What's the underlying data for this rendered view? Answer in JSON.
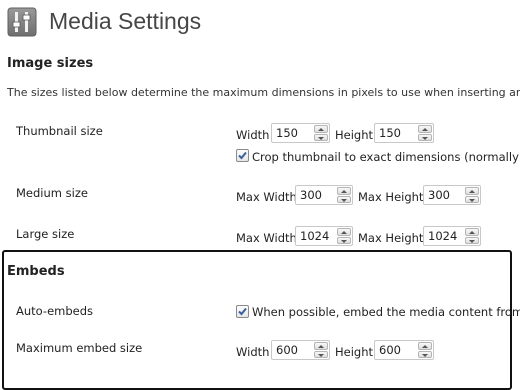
{
  "header": {
    "title": "Media Settings",
    "icon": "settings-sliders-icon"
  },
  "image_sizes": {
    "title": "Image sizes",
    "description": "The sizes listed below determine the maximum dimensions in pixels to use when inserting an",
    "thumbnail": {
      "label": "Thumbnail size",
      "width_label": "Width",
      "width_value": "150",
      "height_label": "Height",
      "height_value": "150",
      "crop_checked": true,
      "crop_label": "Crop thumbnail to exact dimensions (normally thu"
    },
    "medium": {
      "label": "Medium size",
      "width_label": "Max Width",
      "width_value": "300",
      "height_label": "Max Height",
      "height_value": "300"
    },
    "large": {
      "label": "Large size",
      "width_label": "Max Width",
      "width_value": "1024",
      "height_label": "Max Height",
      "height_value": "1024"
    }
  },
  "embeds": {
    "title": "Embeds",
    "auto_embeds": {
      "label": "Auto-embeds",
      "checked": true,
      "text": "When possible, embed the media content from a"
    },
    "max_embed": {
      "label": "Maximum embed size",
      "width_label": "Width",
      "width_value": "600",
      "height_label": "Height",
      "height_value": "600"
    }
  },
  "colors": {
    "highlight_border": "#111111",
    "title_text": "#464646",
    "checkmark": "#3a5f9f"
  }
}
